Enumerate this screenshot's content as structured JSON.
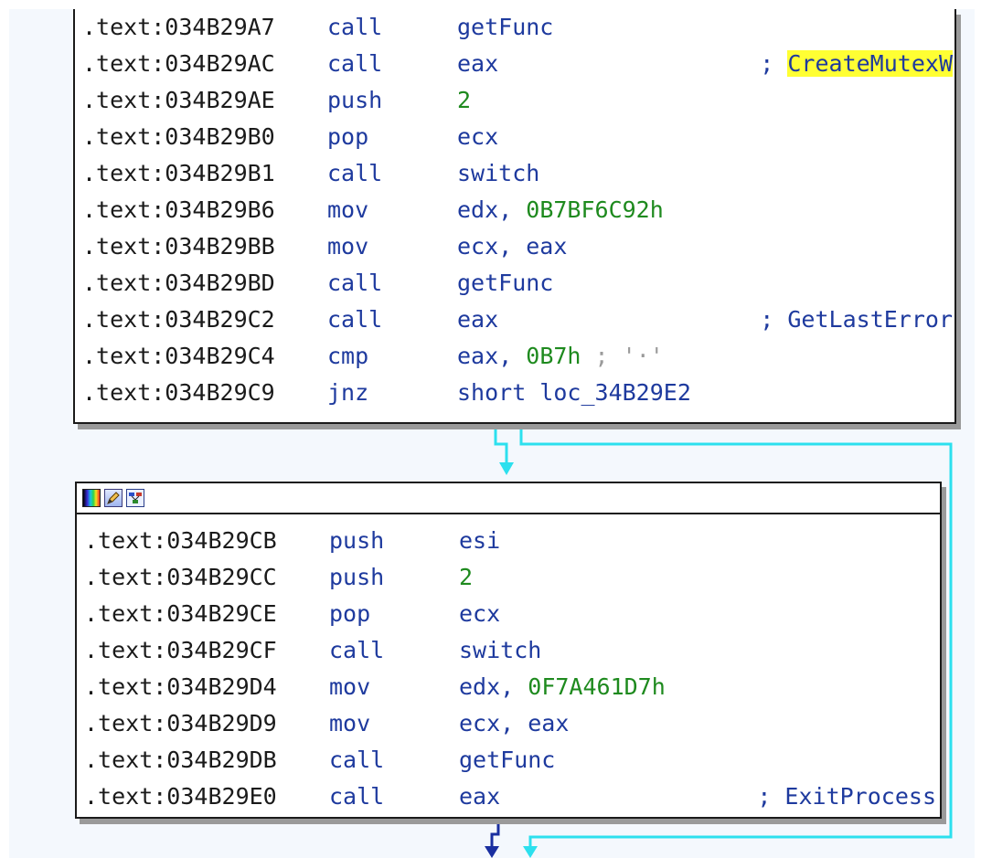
{
  "colors": {
    "canvas_bg": "#f4f8fd",
    "address": "#1a1a1a",
    "mnemonic": "#1e3a9e",
    "immediate": "#1e8a1e",
    "comment_gray": "#9a9a9a",
    "highlight": "#ffff33",
    "edge_cyan": "#2ce0ee",
    "edge_blue": "#1a2fa0"
  },
  "header_icons": [
    "color-palette-icon",
    "rename-node-icon",
    "graph-overview-icon"
  ],
  "top_block": {
    "lines": [
      {
        "address": ".text:034B29A7",
        "mnemonic": "call",
        "operand": "getFunc",
        "imm": "",
        "inline_comment": "",
        "comment": ""
      },
      {
        "address": ".text:034B29AC",
        "mnemonic": "call",
        "operand": "eax",
        "imm": "",
        "inline_comment": "",
        "comment": "; ",
        "comment_name": "CreateMutexW"
      },
      {
        "address": ".text:034B29AE",
        "mnemonic": "push",
        "operand": "",
        "imm": "2",
        "inline_comment": "",
        "comment": ""
      },
      {
        "address": ".text:034B29B0",
        "mnemonic": "pop",
        "operand": "ecx",
        "imm": "",
        "inline_comment": "",
        "comment": ""
      },
      {
        "address": ".text:034B29B1",
        "mnemonic": "call",
        "operand": "switch",
        "imm": "",
        "inline_comment": "",
        "comment": ""
      },
      {
        "address": ".text:034B29B6",
        "mnemonic": "mov",
        "operand": "edx, ",
        "imm": "0B7BF6C92h",
        "inline_comment": "",
        "comment": ""
      },
      {
        "address": ".text:034B29BB",
        "mnemonic": "mov",
        "operand": "ecx, eax",
        "imm": "",
        "inline_comment": "",
        "comment": ""
      },
      {
        "address": ".text:034B29BD",
        "mnemonic": "call",
        "operand": "getFunc",
        "imm": "",
        "inline_comment": "",
        "comment": ""
      },
      {
        "address": ".text:034B29C2",
        "mnemonic": "call",
        "operand": "eax",
        "imm": "",
        "inline_comment": "",
        "comment": "; GetLastError"
      },
      {
        "address": ".text:034B29C4",
        "mnemonic": "cmp",
        "operand": "eax, ",
        "imm": "0B7h",
        "inline_comment": " ; '·'",
        "comment": ""
      },
      {
        "address": ".text:034B29C9",
        "mnemonic": "jnz",
        "operand": "short loc_34B29E2",
        "imm": "",
        "inline_comment": "",
        "comment": ""
      }
    ]
  },
  "bottom_block": {
    "lines": [
      {
        "address": ".text:034B29CB",
        "mnemonic": "push",
        "operand": "esi",
        "imm": "",
        "comment": ""
      },
      {
        "address": ".text:034B29CC",
        "mnemonic": "push",
        "operand": "",
        "imm": "2",
        "comment": ""
      },
      {
        "address": ".text:034B29CE",
        "mnemonic": "pop",
        "operand": "ecx",
        "imm": "",
        "comment": ""
      },
      {
        "address": ".text:034B29CF",
        "mnemonic": "call",
        "operand": "switch",
        "imm": "",
        "comment": ""
      },
      {
        "address": ".text:034B29D4",
        "mnemonic": "mov",
        "operand": "edx, ",
        "imm": "0F7A461D7h",
        "comment": ""
      },
      {
        "address": ".text:034B29D9",
        "mnemonic": "mov",
        "operand": "ecx, eax",
        "imm": "",
        "comment": ""
      },
      {
        "address": ".text:034B29DB",
        "mnemonic": "call",
        "operand": "getFunc",
        "imm": "",
        "comment": ""
      },
      {
        "address": ".text:034B29E0",
        "mnemonic": "call",
        "operand": "eax",
        "imm": "",
        "comment": "; ExitProcess"
      }
    ]
  }
}
